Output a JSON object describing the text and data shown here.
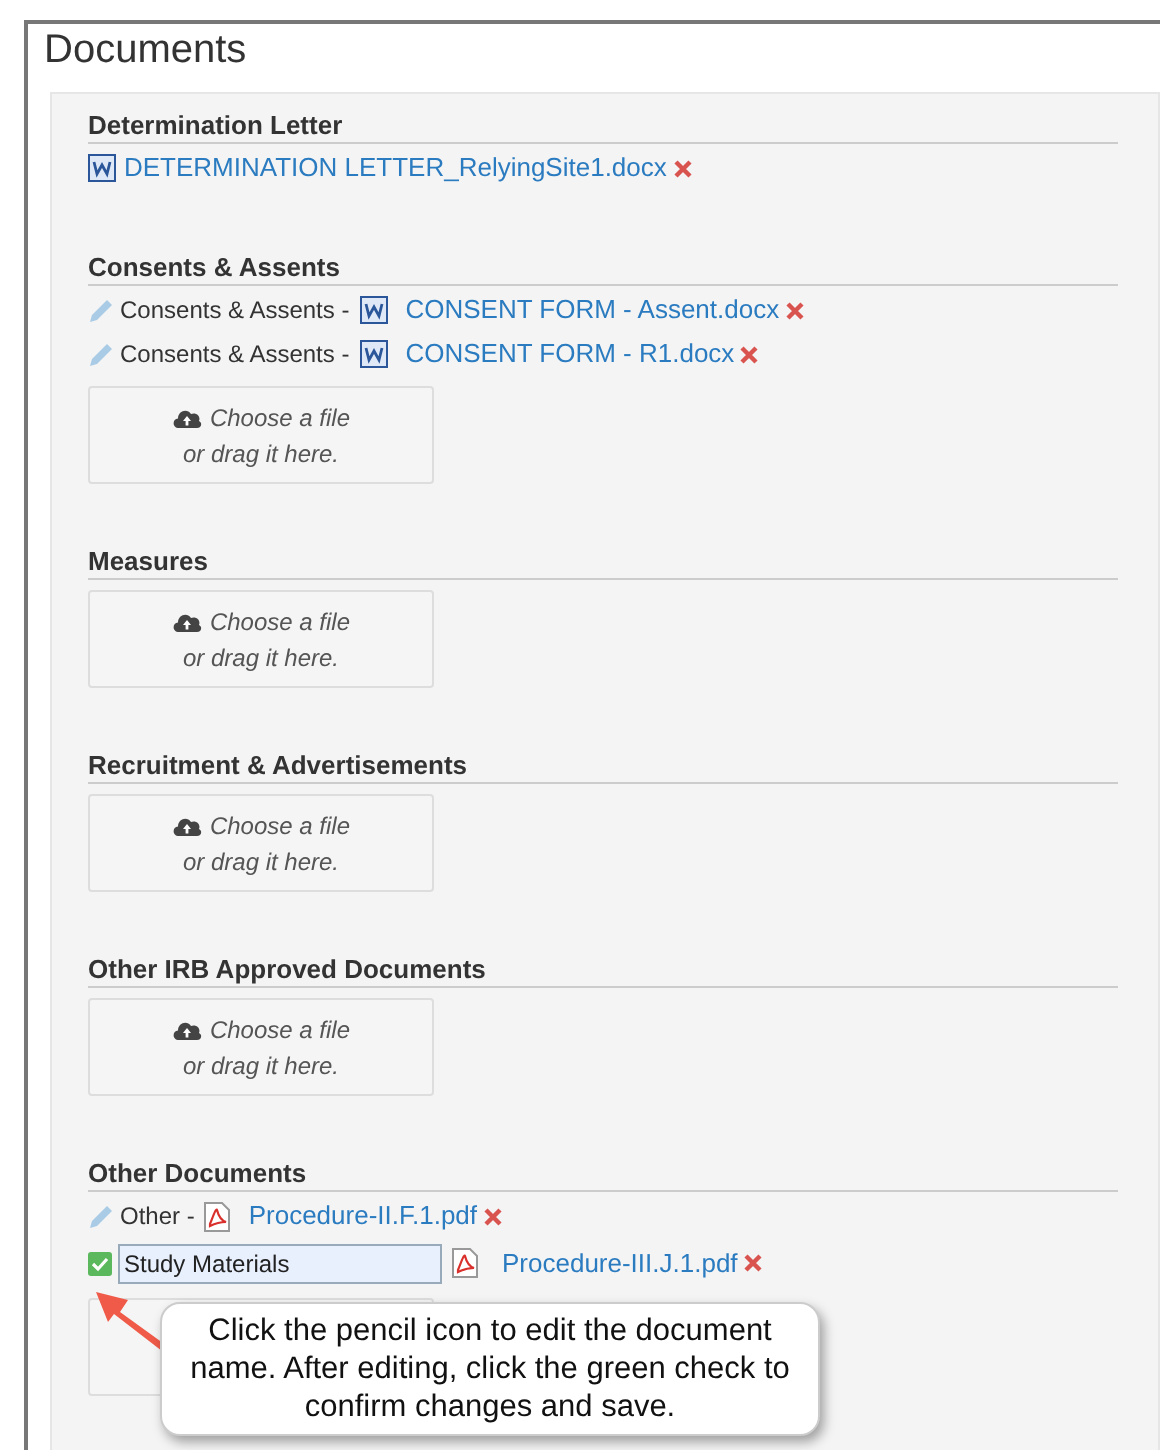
{
  "title": "Documents",
  "sections": [
    {
      "heading": "Determination Letter",
      "items": [
        {
          "kind": "word_file",
          "name": "DETERMINATION LETTER_RelyingSite1.docx"
        }
      ],
      "dropzone": false
    },
    {
      "heading": "Consents & Assents",
      "items": [
        {
          "kind": "word_labeled",
          "label": "Consents & Assents -",
          "name": "CONSENT FORM - Assent.docx"
        },
        {
          "kind": "word_labeled",
          "label": "Consents & Assents -",
          "name": "CONSENT FORM - R1.docx"
        }
      ],
      "dropzone": true,
      "dropzone_text": [
        "Choose a file",
        "or drag it here."
      ]
    },
    {
      "heading": "Measures",
      "dropzone": true,
      "dropzone_text": [
        "Choose a file",
        "or drag it here."
      ]
    },
    {
      "heading": "Recruitment & Advertisements",
      "dropzone": true,
      "dropzone_text": [
        "Choose a file",
        "or drag it here."
      ]
    },
    {
      "heading": "Other IRB Approved Documents",
      "dropzone": true,
      "dropzone_text": [
        "Choose a file",
        "or drag it here."
      ]
    },
    {
      "heading": "Other Documents",
      "items": [
        {
          "kind": "pdf_labeled",
          "label": "Other -",
          "name": "Procedure-II.F.1.pdf"
        },
        {
          "kind": "pdf_editing",
          "value": "Study Materials",
          "name": "Procedure-III.J.1.pdf"
        }
      ],
      "dropzone": true
    }
  ],
  "callout": {
    "text": "Click the pencil icon to edit the document name. After editing, click the green check to confirm changes and save."
  }
}
